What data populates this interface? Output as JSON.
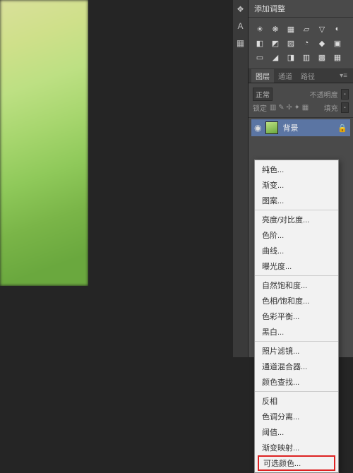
{
  "tool_icons": {
    "history": "❖",
    "text": "A",
    "swatch": "▦"
  },
  "panel": {
    "title": "添加调整",
    "icon_rows": [
      [
        "☀",
        "❋",
        "▦",
        "▱",
        "▽",
        "◐"
      ],
      [
        "◧",
        "◩",
        "▨",
        "◔",
        "◆",
        "▣"
      ],
      [
        "▭",
        "◢",
        "◨",
        "▥",
        "▩",
        "▦"
      ]
    ],
    "tabs": [
      "图层",
      "通道",
      "路径"
    ],
    "options": {
      "label1": "正常",
      "label2": "不透明度",
      "val2": "-",
      "label3": "锁定",
      "icons": "▥ ✎ ✢ ✦ ▦",
      "label4": "填充",
      "val4": "-"
    },
    "layer": {
      "name": "背景"
    }
  },
  "menu": {
    "g1": [
      "纯色...",
      "渐变...",
      "图案..."
    ],
    "g2": [
      "亮度/对比度...",
      "色阶...",
      "曲线...",
      "曝光度..."
    ],
    "g3": [
      "自然饱和度...",
      "色相/饱和度...",
      "色彩平衡...",
      "黑白..."
    ],
    "g4": [
      "照片滤镜...",
      "通道混合器...",
      "颜色查找..."
    ],
    "g5": [
      "反相",
      "色调分离...",
      "阈值...",
      "渐变映射..."
    ],
    "highlight": "可选颜色..."
  }
}
